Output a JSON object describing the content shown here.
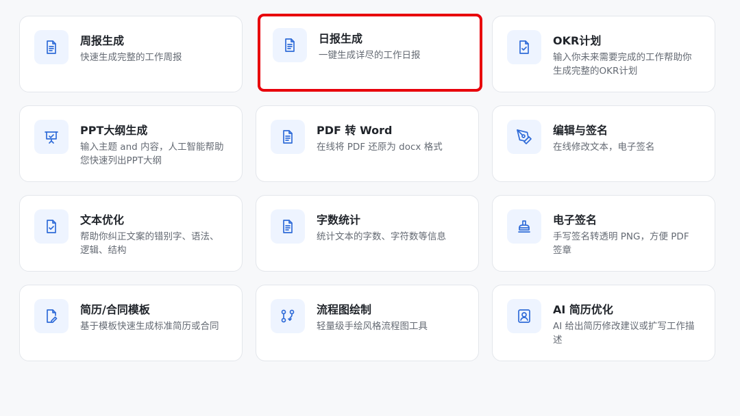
{
  "accent_color": "#2f6bd8",
  "highlight_color": "#e8000b",
  "tools": [
    {
      "title": "周报生成",
      "desc": "快速生成完整的工作周报",
      "icon": "document-icon",
      "selected": false
    },
    {
      "title": "日报生成",
      "desc": "一键生成详尽的工作日报",
      "icon": "document-icon",
      "selected": true
    },
    {
      "title": "OKR计划",
      "desc": "输入你未来需要完成的工作帮助你生成完整的OKR计划",
      "icon": "document-check-icon",
      "selected": false
    },
    {
      "title": "PPT大纲生成",
      "desc": "输入主题 and 内容，人工智能帮助您快速列出PPT大纲",
      "icon": "presentation-icon",
      "selected": false
    },
    {
      "title": "PDF 转 Word",
      "desc": "在线将 PDF 还原为 docx 格式",
      "icon": "document-icon",
      "selected": false
    },
    {
      "title": "编辑与签名",
      "desc": "在线修改文本，电子签名",
      "icon": "pen-nib-icon",
      "selected": false
    },
    {
      "title": "文本优化",
      "desc": "帮助你纠正文案的错别字、语法、逻辑、结构",
      "icon": "document-check-icon",
      "selected": false
    },
    {
      "title": "字数统计",
      "desc": "统计文本的字数、字符数等信息",
      "icon": "document-icon",
      "selected": false
    },
    {
      "title": "电子签名",
      "desc": "手写签名转透明 PNG，方便 PDF 签章",
      "icon": "stamp-icon",
      "selected": false
    },
    {
      "title": "简历/合同模板",
      "desc": "基于模板快速生成标准简历或合同",
      "icon": "document-edit-icon",
      "selected": false
    },
    {
      "title": "流程图绘制",
      "desc": "轻量级手绘风格流程图工具",
      "icon": "flow-icon",
      "selected": false
    },
    {
      "title": "AI 简历优化",
      "desc": "AI 给出简历修改建议或扩写工作描述",
      "icon": "user-card-icon",
      "selected": false
    }
  ]
}
